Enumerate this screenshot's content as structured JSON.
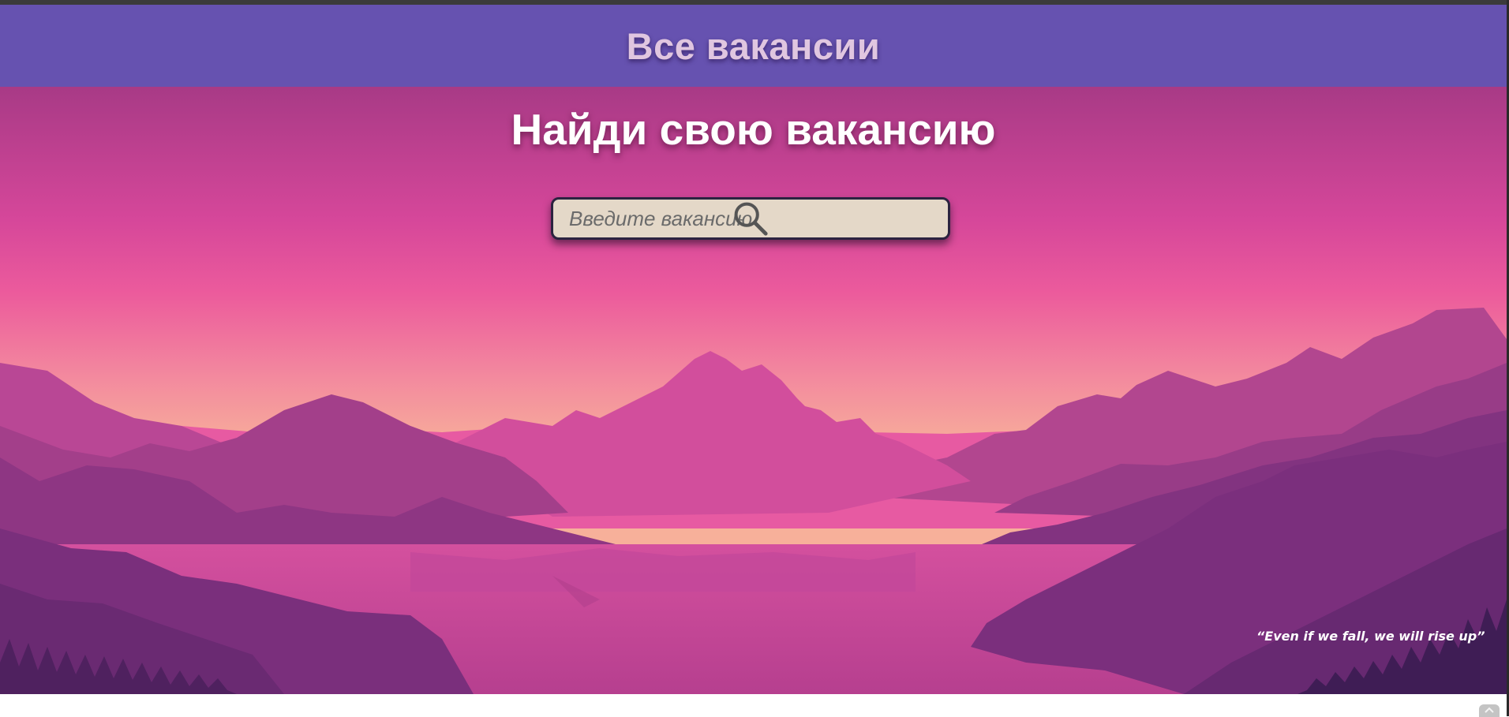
{
  "header": {
    "title": "Все вакансии",
    "background_color": "#6652b0",
    "title_color": "#e0c6e0"
  },
  "hero": {
    "title": "Найди свою вакансию",
    "background_theme": "pink-purple mountain landscape at dusk",
    "quote": "“Even if we fall, we will rise up”"
  },
  "search": {
    "placeholder": "Введите вакансию",
    "value": "",
    "icon": "search-icon",
    "background_color": "#e4d8c8"
  },
  "footer": {
    "corner_icon": "scroll-up-icon"
  }
}
